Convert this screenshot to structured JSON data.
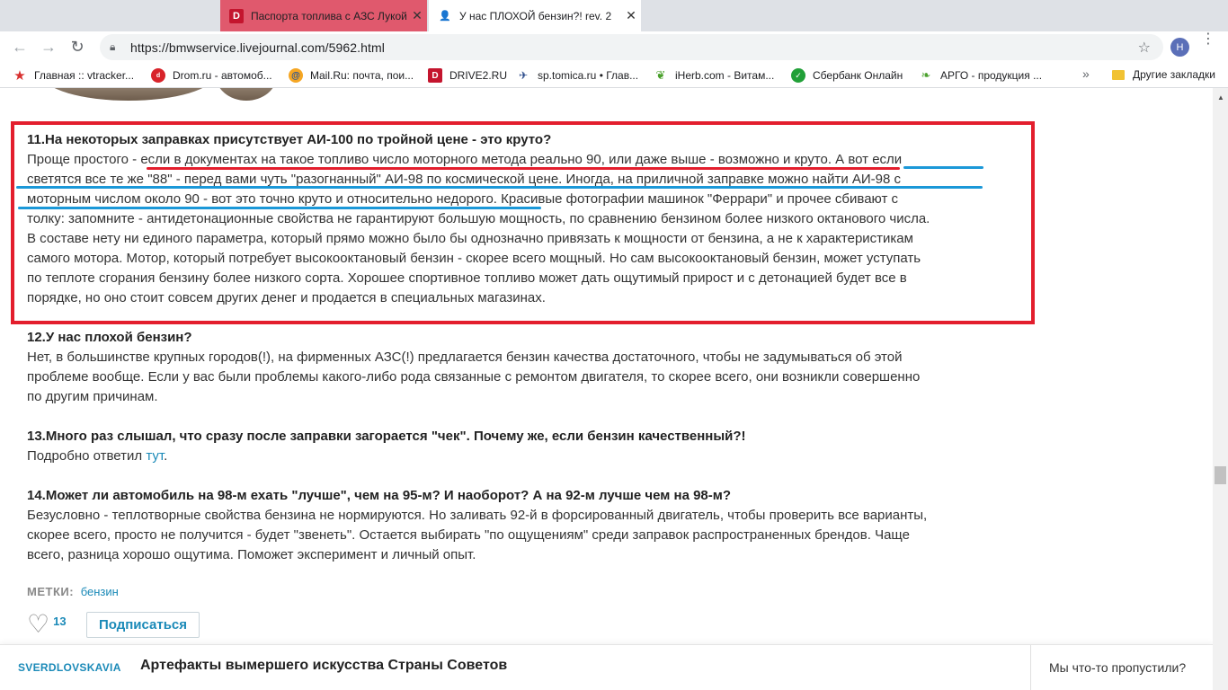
{
  "browser": {
    "tabs": [
      {
        "title": "Паспорта топлива с АЗС Лукойл",
        "active": false
      },
      {
        "title": "У нас ПЛОХОЙ бензин?! rev. 2",
        "active": true
      }
    ],
    "url": "https://bmwservice.livejournal.com/5962.html",
    "profile_initial": "Н",
    "bookmarks": [
      {
        "label": "Главная :: vtracker...",
        "icon": "red-star-icon"
      },
      {
        "label": "Drom.ru - автомоб...",
        "icon": "drom-icon"
      },
      {
        "label": "Mail.Ru: почта, пои...",
        "icon": "mailru-icon"
      },
      {
        "label": "DRIVE2.RU",
        "icon": "drive2-icon"
      },
      {
        "label": "sp.tomica.ru • Глав...",
        "icon": "tomica-icon"
      },
      {
        "label": "iHerb.com - Витам...",
        "icon": "iherb-icon"
      },
      {
        "label": "Сбербанк Онлайн",
        "icon": "sberbank-icon"
      },
      {
        "label": "АРГО - продукция ...",
        "icon": "argo-icon"
      }
    ],
    "more_bookmarks": "»",
    "other_bookmarks": "Другие закладки"
  },
  "article": {
    "q11": {
      "title": "11.На некоторых заправках присутствует АИ-100 по тройной цене - это круто?",
      "lines": [
        "Проще простого - если в документах на такое топливо число моторного метода реально 90, или даже выше - возможно и круто. А вот если",
        "светятся все те же \"88\" - перед вами чуть \"разогнанный\" АИ-98 по космической цене. Иногда, на приличной заправке можно найти АИ-98 с",
        "моторным числом около 90 - вот это точно круто и относительно недорого. Красивые фотографии машинок \"Феррари\" и прочее сбивают с",
        "толку: запомните - антидетонационные свойства не гарантируют большую мощность, по сравнению бензином более низкого октанового числа.",
        "В составе нету ни единого параметра, который прямо можно было бы однозначно привязать к мощности от бензина, а не к характеристикам",
        "самого мотора. Мотор, который потребует высокооктановый бензин - скорее всего мощный. Но сам высокооктановый бензин, может уступать",
        "по теплоте сгорания бензину более низкого сорта. Хорошее спортивное топливо может дать ощутимый прирост и с детонацией будет все в",
        "порядке, но оно стоит совсем других денег и продается в специальных магазинах."
      ]
    },
    "q12": {
      "title": "12.У нас плохой бензин?",
      "lines": [
        "Нет, в большинстве крупных городов(!), на фирменных АЗС(!) предлагается бензин качества достаточного, чтобы не задумываться об этой",
        "проблеме вообще. Если у вас были проблемы какого-либо рода связанные с ремонтом двигателя, то скорее всего, они возникли совершенно",
        "по другим причинам."
      ]
    },
    "q13": {
      "title": "13.Много раз слышал, что сразу после заправки загорается \"чек\". Почему же, если бензин качественный?!",
      "text_before": "Подробно ответил ",
      "link": "тут",
      "text_after": "."
    },
    "q14": {
      "title": "14.Может ли автомобиль на 98-м ехать \"лучше\", чем на 95-м? И наоборот? А на 92-м лучше чем на 98-м?",
      "lines": [
        "Безусловно - теплотворные свойства бензина не нормируются. Но заливать 92-й в форсированный двигатель, чтобы проверить все варианты,",
        "скорее всего, просто не получится - будет \"звенеть\". Остается выбирать \"по ощущениям\" среди заправок распространенных брендов. Чаще",
        "всего, разница хорошо ощутима. Поможет эксперимент и личный опыт."
      ]
    }
  },
  "tags": {
    "label": "МЕТКИ:",
    "values": [
      "бензин"
    ]
  },
  "like_count": "13",
  "subscribe_label": "Подписаться",
  "footer": {
    "journal": "SVERDLOVSKAVIA",
    "title": "Артефакты вымершего искусства Страны Советов",
    "missed": "Мы что-то пропустили?"
  },
  "colors": {
    "highlight_red": "#e31e2d",
    "underline_blue": "#1b98d8",
    "link_blue": "#1b8ab8"
  }
}
